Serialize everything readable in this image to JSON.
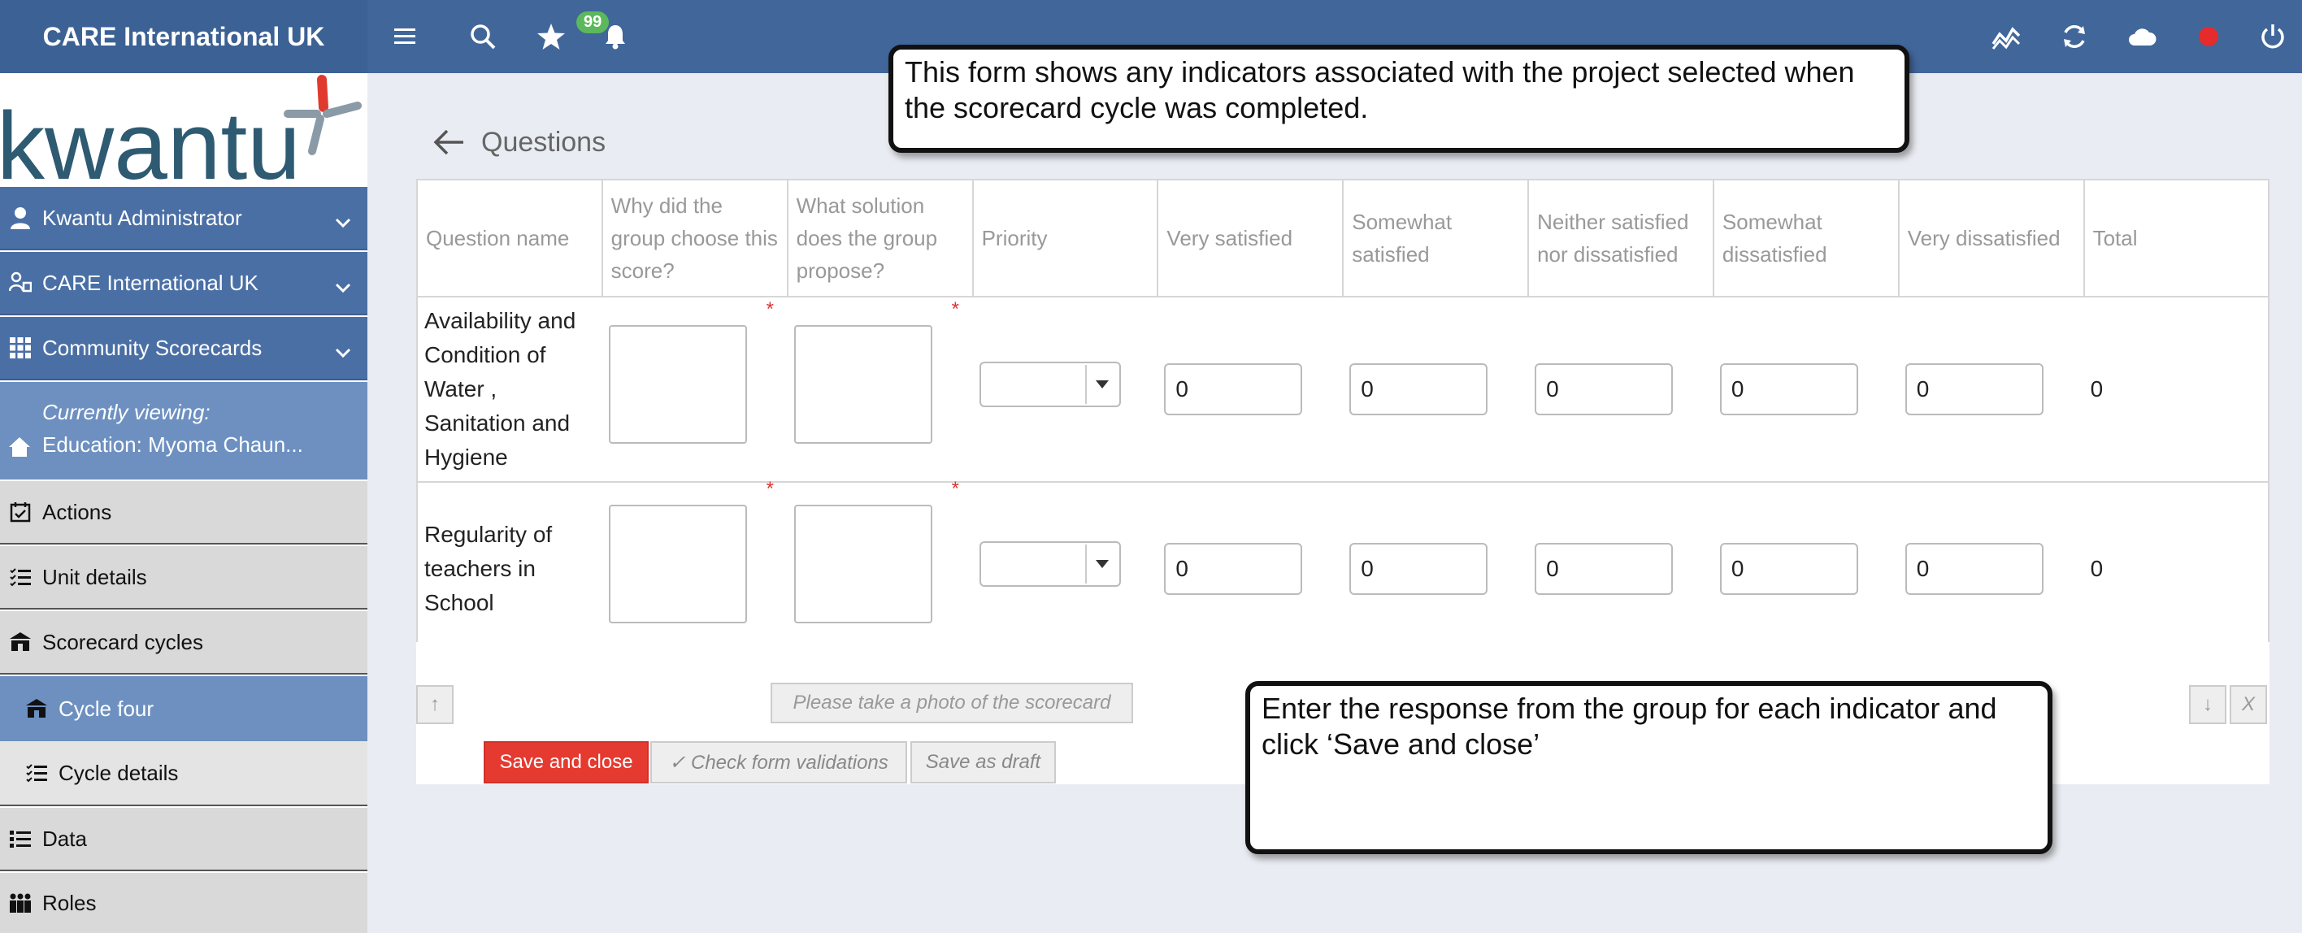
{
  "header": {
    "brand": "CARE International UK",
    "notification_count": "99"
  },
  "sidebar": {
    "logo_text": "kwantu",
    "items": [
      {
        "label": "Kwantu Administrator"
      },
      {
        "label": "CARE International UK"
      },
      {
        "label": "Community Scorecards"
      }
    ],
    "viewing_label": "Currently viewing:",
    "viewing_value": "Education: Myoma Chaun...",
    "menu": [
      {
        "label": "Actions"
      },
      {
        "label": "Unit details"
      },
      {
        "label": "Scorecard cycles"
      },
      {
        "label": "Cycle four"
      },
      {
        "label": "Cycle details"
      },
      {
        "label": "Data"
      },
      {
        "label": "Roles"
      }
    ]
  },
  "main": {
    "title": "Questions",
    "columns": [
      "Question name",
      "Why did the group choose this score?",
      "What solution does the group propose?",
      "Priority",
      "Very satisfied",
      "Somewhat satisfied",
      "Neither satisfied nor dissatisfied",
      "Somewhat dissatisfied",
      "Very dissatisfied",
      "Total"
    ],
    "rows": [
      {
        "name": "Availability and Condition of Water , Sanitation and Hygiene",
        "very_satisfied": "0",
        "somewhat_satisfied": "0",
        "neither": "0",
        "somewhat_dissatisfied": "0",
        "very_dissatisfied": "0",
        "total": "0"
      },
      {
        "name": "Regularity of teachers in School",
        "very_satisfied": "0",
        "somewhat_satisfied": "0",
        "neither": "0",
        "somewhat_dissatisfied": "0",
        "very_dissatisfied": "0",
        "total": "0"
      }
    ],
    "required_mark": "*",
    "photo_button": "Please take a photo of the scorecard",
    "save_close": "Save and close",
    "check_validations": "✓ Check form validations",
    "save_draft": "Save as draft",
    "up_arrow": "↑",
    "down_arrow": "↓",
    "close_x": "X"
  },
  "callouts": {
    "top": "This form shows any indicators associated with the project selected when the scorecard cycle was completed.",
    "bottom": "Enter the response from the group for each indicator and click ‘Save and close’"
  },
  "colors": {
    "topbar": "#41669a",
    "sidebar_blue": "#4a6fa5",
    "save_red": "#e53a30",
    "badge_green": "#5cb85c"
  }
}
